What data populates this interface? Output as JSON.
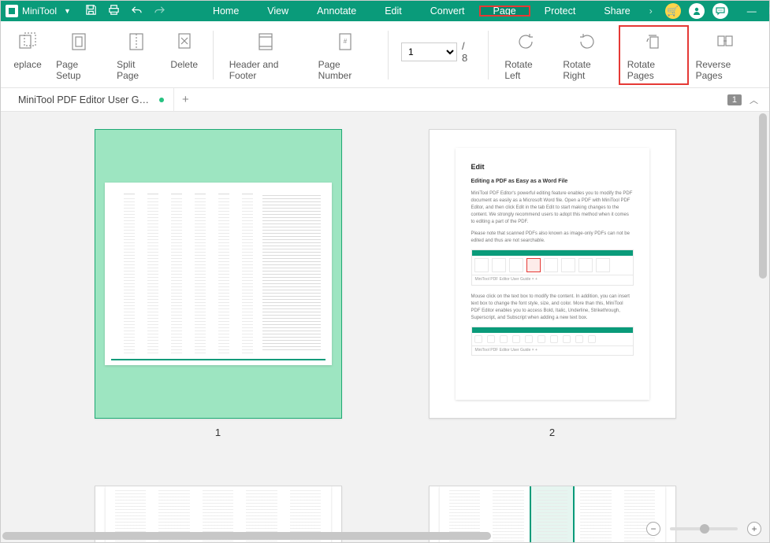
{
  "app": {
    "name": "MiniTool"
  },
  "titlebar": {
    "menus": [
      "Home",
      "View",
      "Annotate",
      "Edit",
      "Convert",
      "Page",
      "Protect",
      "Share"
    ],
    "active_index": 5
  },
  "ribbon": {
    "group1": [
      {
        "label": "Replace",
        "cropped": "eplace"
      },
      {
        "label": "Page Setup"
      },
      {
        "label": "Split Page"
      },
      {
        "label": "Delete"
      }
    ],
    "group2": [
      {
        "label": "Header and Footer"
      },
      {
        "label": "Page Number"
      }
    ],
    "pagefield": {
      "current": "1",
      "total": "/ 8"
    },
    "group3": [
      {
        "label": "Rotate Left"
      },
      {
        "label": "Rotate Right"
      },
      {
        "label": "Rotate Pages",
        "highlighted": true
      },
      {
        "label": "Reverse Pages"
      }
    ]
  },
  "tabs": {
    "items": [
      {
        "label": "MiniTool PDF Editor User Guid...",
        "dirty": true
      }
    ],
    "page_badge": "1"
  },
  "thumbs": {
    "pages": [
      {
        "num": "1",
        "selected": true
      },
      {
        "num": "2",
        "selected": false
      }
    ]
  },
  "p2content": {
    "h3": "Edit",
    "h4": "Editing a PDF as Easy as a Word File",
    "para1": "MiniTool PDF Editor's powerful editing feature enables you to modify the PDF document as easily as a Microsoft Word file. Open a PDF with MiniTool PDF Editor, and then click Edit in the tab Edit to start making changes to the content. We strongly recommend users to adopt this method when it comes to editing a part of the PDF.",
    "para2": "Please note that scanned PDFs also known as image-only PDFs can not be edited and thus are not searchable.",
    "para3": "Mouse click on the text box to modify the content. In addition, you can insert text box to change the font style, size, and color. More than this, MiniTool PDF Editor enables you to access Bold, Italic, Underline, Strikethrough, Superscript, and Subscript when adding a new text box.",
    "mini_tab": "MiniTool PDF Editor User Guide  ×   +"
  }
}
